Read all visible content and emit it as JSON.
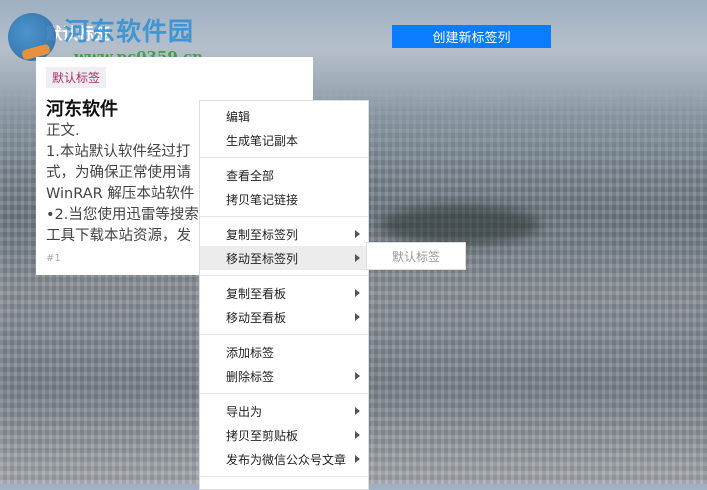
{
  "header": {
    "title": "默认标签",
    "create_button": "创建新标签列"
  },
  "watermark": {
    "name": "河东软件园",
    "url": "www.pc0359.cn"
  },
  "card": {
    "tag": "默认标签",
    "title": "河东软件",
    "lines": [
      "正文.",
      "1.本站默认软件经过打",
      "式，为确保正常使用请",
      "WinRAR 解压本站软件",
      "•2.当您使用迅雷等搜索",
      "工具下载本站资源，发"
    ],
    "number": "#1"
  },
  "menu": {
    "groups": [
      [
        {
          "label": "编辑"
        },
        {
          "label": "生成笔记副本"
        }
      ],
      [
        {
          "label": "查看全部"
        },
        {
          "label": "拷贝笔记链接"
        }
      ],
      [
        {
          "label": "复制至标签列",
          "submenu": true
        },
        {
          "label": "移动至标签列",
          "submenu": true,
          "active": true
        }
      ],
      [
        {
          "label": "复制至看板",
          "submenu": true
        },
        {
          "label": "移动至看板",
          "submenu": true
        }
      ],
      [
        {
          "label": "添加标签"
        },
        {
          "label": "删除标签",
          "submenu": true
        }
      ],
      [
        {
          "label": "导出为",
          "submenu": true
        },
        {
          "label": "拷贝至剪贴板",
          "submenu": true
        },
        {
          "label": "发布为微信公众号文章",
          "submenu": true
        }
      ]
    ]
  },
  "submenu": {
    "items": [
      "默认标签"
    ]
  }
}
